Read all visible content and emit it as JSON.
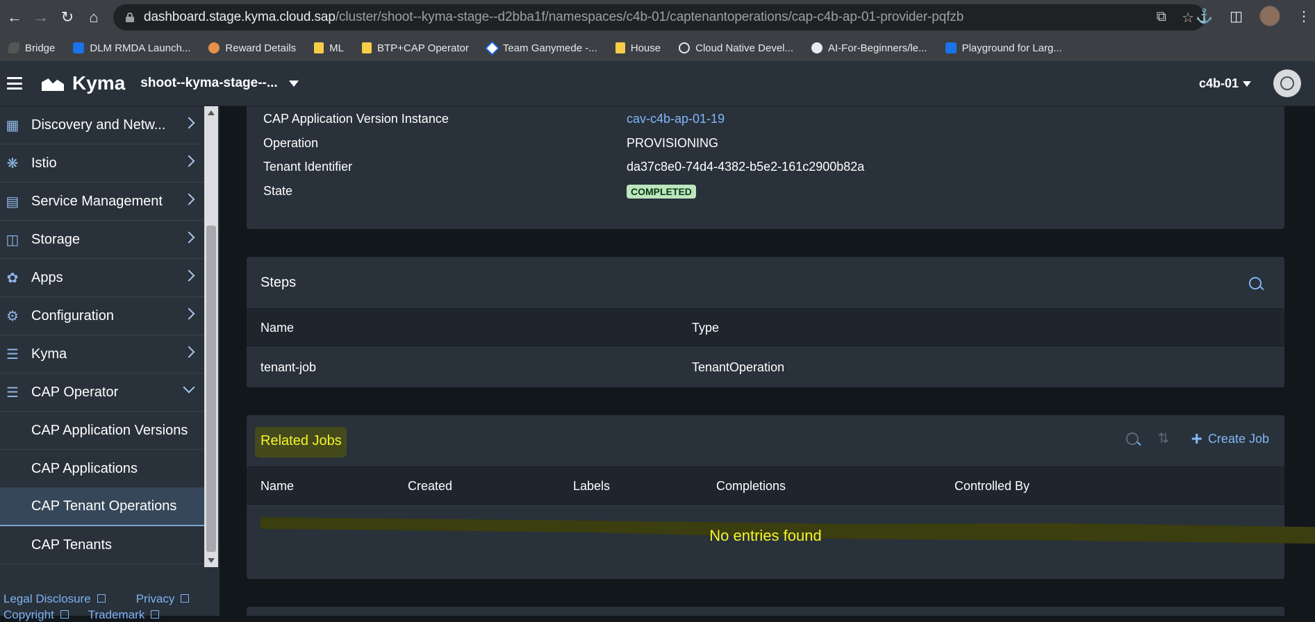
{
  "browser": {
    "url_host": "dashboard.stage.kyma.cloud.sap",
    "url_path": "/cluster/shoot--kyma-stage--d2bba1f/namespaces/c4b-01/captenantoperations/cap-c4b-ap-01-provider-pqfzb",
    "bookmarks": [
      {
        "label": "Bridge",
        "icon": "leaf-icon"
      },
      {
        "label": "DLM RMDA Launch...",
        "icon": "sap-icon"
      },
      {
        "label": "Reward Details",
        "icon": "gift-icon"
      },
      {
        "label": "ML",
        "icon": "folder-icon"
      },
      {
        "label": "BTP+CAP Operator",
        "icon": "folder-icon"
      },
      {
        "label": "Team Ganymede -...",
        "icon": "jira-icon"
      },
      {
        "label": "House",
        "icon": "folder-icon"
      },
      {
        "label": "Cloud Native Devel...",
        "icon": "globe-icon"
      },
      {
        "label": "AI-For-Beginners/le...",
        "icon": "github-icon"
      },
      {
        "label": "Playground for Larg...",
        "icon": "sap-icon"
      }
    ]
  },
  "shell": {
    "product": "Kyma",
    "cluster": "shoot--kyma-stage--...",
    "namespace": "c4b-01"
  },
  "sidebar": {
    "items": [
      {
        "label": "Discovery and Netw...",
        "icon": "network-icon",
        "expanded": false
      },
      {
        "label": "Istio",
        "icon": "istio-icon",
        "expanded": false
      },
      {
        "label": "Service Management",
        "icon": "service-icon",
        "expanded": false
      },
      {
        "label": "Storage",
        "icon": "storage-icon",
        "expanded": false
      },
      {
        "label": "Apps",
        "icon": "apps-icon",
        "expanded": false
      },
      {
        "label": "Configuration",
        "icon": "gear-icon",
        "expanded": false
      },
      {
        "label": "Kyma",
        "icon": "sliders-icon",
        "expanded": false
      },
      {
        "label": "CAP Operator",
        "icon": "sliders-icon",
        "expanded": true
      }
    ],
    "sub_items": [
      {
        "label": "CAP Application Versions",
        "selected": false
      },
      {
        "label": "CAP Applications",
        "selected": false
      },
      {
        "label": "CAP Tenant Operations",
        "selected": true
      },
      {
        "label": "CAP Tenants",
        "selected": false
      }
    ],
    "footer": {
      "legal": "Legal Disclosure",
      "privacy": "Privacy",
      "copyright": "Copyright",
      "trademark": "Trademark"
    }
  },
  "details": {
    "rows": [
      {
        "key": "CAP Application Version Instance",
        "value": "cav-c4b-ap-01-19"
      },
      {
        "key": "Operation",
        "value": "PROVISIONING"
      },
      {
        "key": "Tenant Identifier",
        "value": "da37c8e0-74d4-4382-b5e2-161c2900b82a"
      },
      {
        "key": "State",
        "value": "COMPLETED"
      }
    ]
  },
  "steps": {
    "title": "Steps",
    "columns": [
      "Name",
      "Type"
    ],
    "rows": [
      {
        "name": "tenant-job",
        "type": "TenantOperation"
      }
    ]
  },
  "jobs": {
    "title": "Related Jobs",
    "create_label": "Create Job",
    "columns": [
      "Name",
      "Created",
      "Labels",
      "Completions",
      "Controlled By"
    ],
    "empty_text": "No entries found"
  }
}
